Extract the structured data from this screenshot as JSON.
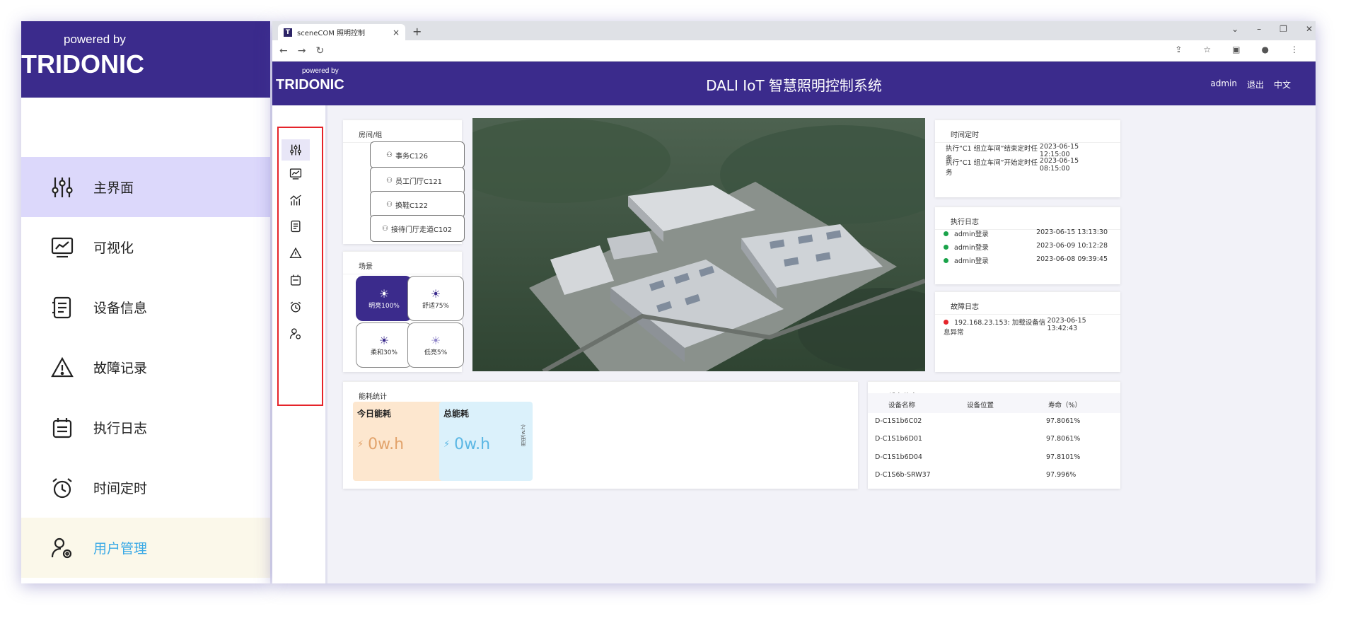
{
  "callout": {
    "powered_by": "powered by",
    "logo": "TRIDONIC",
    "menu": [
      {
        "label": "主界面",
        "icon": "sliders-icon"
      },
      {
        "label": "可视化",
        "icon": "chart-monitor-icon"
      },
      {
        "label": "设备信息",
        "icon": "device-list-icon"
      },
      {
        "label": "故障记录",
        "icon": "warning-icon"
      },
      {
        "label": "执行日志",
        "icon": "log-calendar-icon"
      },
      {
        "label": "时间定时",
        "icon": "alarm-clock-icon"
      },
      {
        "label": "用户管理",
        "icon": "user-settings-icon"
      }
    ]
  },
  "browser": {
    "tab_title": "sceneCOM 照明控制",
    "tab_favicon": "T",
    "tab_close": "×",
    "new_tab": "+"
  },
  "app": {
    "powered_by": "powered by",
    "logo": "TRIDONIC",
    "title": "DALI IoT 智慧照明控制系统",
    "user": "admin",
    "logout": "退出",
    "language": "中文"
  },
  "rooms": {
    "title": "房间/组",
    "items": [
      "事务C126",
      "员工门厅C121",
      "换鞋C122",
      "接待门厅走道C102"
    ]
  },
  "scenes": {
    "title": "场景",
    "items": [
      {
        "label": "明亮100%",
        "active": true
      },
      {
        "label": "舒适75%",
        "active": false
      },
      {
        "label": "柔和30%",
        "active": false
      },
      {
        "label": "低亮5%",
        "active": false
      }
    ]
  },
  "timer": {
    "title": "时间定时",
    "rows": [
      {
        "text": "执行“C1 组立车间”结束定时任务",
        "time": "2023-06-15 12:15:00"
      },
      {
        "text": "执行“C1 组立车间”开始定时任务",
        "time": "2023-06-15 08:15:00"
      }
    ]
  },
  "exec_log": {
    "title": "执行日志",
    "rows": [
      {
        "text": "admin登录",
        "time": "2023-06-15 13:13:30"
      },
      {
        "text": "admin登录",
        "time": "2023-06-09 10:12:28"
      },
      {
        "text": "admin登录",
        "time": "2023-06-08 09:39:45"
      }
    ]
  },
  "fault_log": {
    "title": "故障日志",
    "rows": [
      {
        "text": "192.168.23.153: 加载设备信息异常",
        "time": "2023-06-15 13:42:43"
      }
    ]
  },
  "energy": {
    "title": "能耗统计",
    "today_label": "今日能耗",
    "today_value": "0w.h",
    "total_label": "总能耗",
    "total_value": "0w.h",
    "axis_label": "用电(w.h)"
  },
  "devices": {
    "title": "设备信息",
    "headers": [
      "设备名称",
      "设备位置",
      "寿命（%）"
    ],
    "rows": [
      {
        "name": "D-C1S1b6C02",
        "location": "",
        "life": "97.8061%"
      },
      {
        "name": "D-C1S1b6D01",
        "location": "",
        "life": "97.8061%"
      },
      {
        "name": "D-C1S1b6D04",
        "location": "",
        "life": "97.8101%"
      },
      {
        "name": "D-C1S6b-SRW37",
        "location": "",
        "life": "97.996%"
      }
    ]
  },
  "colors": {
    "brand": "#3b2b8c",
    "active_menu": "#dcd8fb",
    "user_menu_text": "#39a9e6",
    "highlight_box": "#e5242a",
    "today_card": "#fde7cf",
    "total_card": "#dbf1fb",
    "ok_dot": "#1aa34a",
    "error_dot": "#e5242a"
  }
}
